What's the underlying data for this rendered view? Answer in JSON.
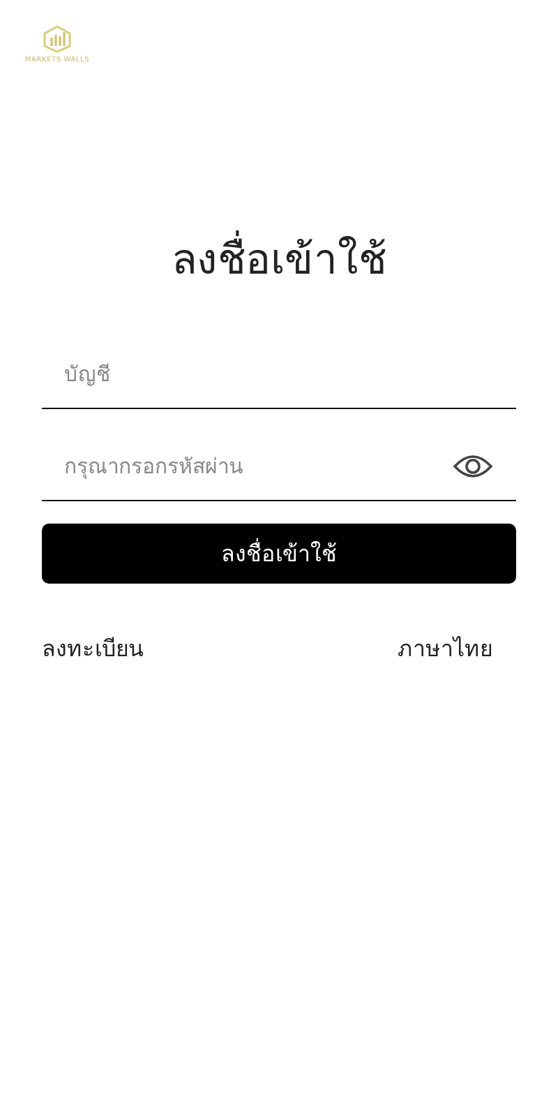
{
  "logo": {
    "text": "MARKETS WALLS"
  },
  "title": "ลงชื่อเข้าใช้",
  "account_field": {
    "placeholder": "บัญชี"
  },
  "password_field": {
    "placeholder": "กรุณากรอกรหัสผ่าน"
  },
  "login_button": "ลงชื่อเข้าใช้",
  "register_link": "ลงทะเบียน",
  "language_link": "ภาษาไทย"
}
